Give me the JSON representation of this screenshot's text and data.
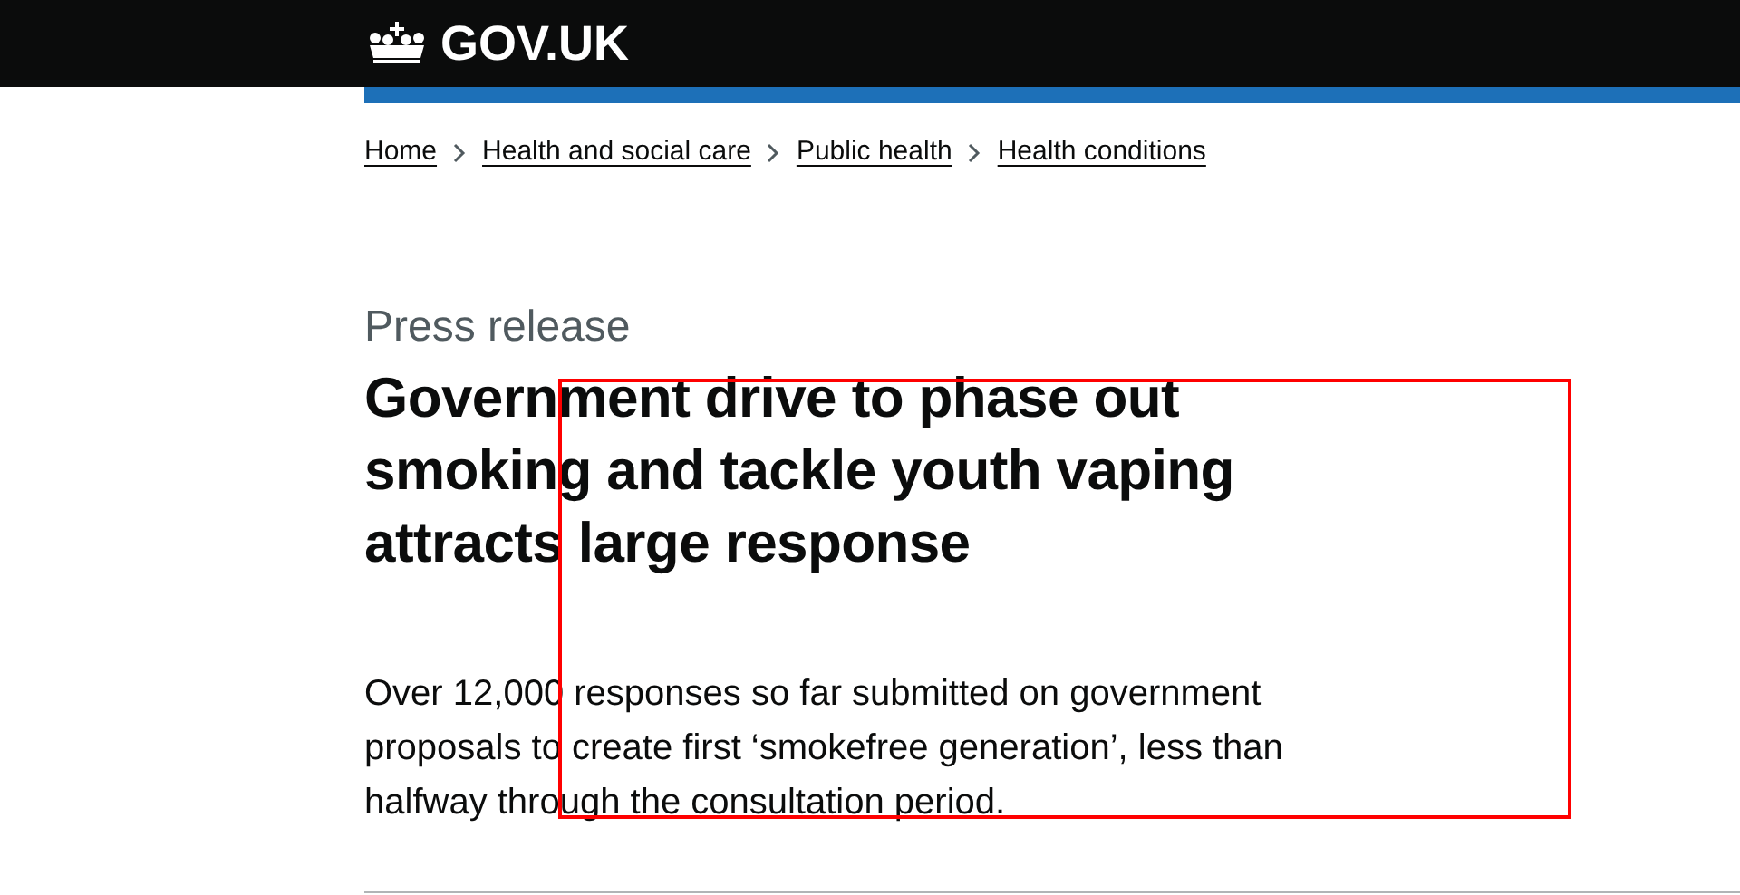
{
  "header": {
    "logo": "GOV.UK"
  },
  "breadcrumbs": [
    {
      "label": "Home"
    },
    {
      "label": "Health and social care"
    },
    {
      "label": "Public health"
    },
    {
      "label": "Health conditions"
    }
  ],
  "article": {
    "type": "Press release",
    "title": "Government drive to phase out smoking and tackle youth vaping attracts large response",
    "summary": "Over 12,000 responses so far submitted on government proposals to create first ‘smokefree generation’, less than halfway through the consultation period."
  },
  "annotation": {
    "kind": "rectangle"
  }
}
